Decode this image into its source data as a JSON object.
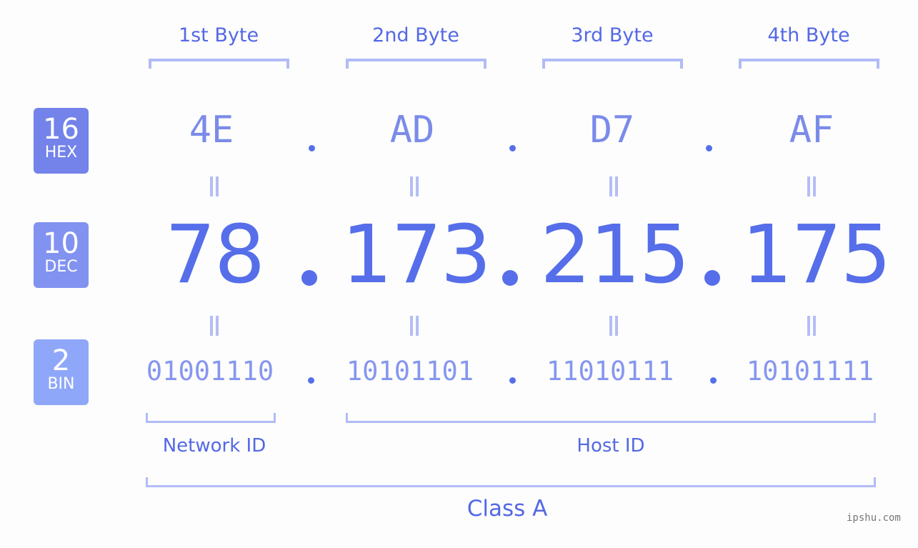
{
  "bytes": [
    {
      "label": "1st Byte",
      "hex": "4E",
      "dec": "78",
      "bin": "01001110"
    },
    {
      "label": "2nd Byte",
      "hex": "AD",
      "dec": "173",
      "bin": "10101101"
    },
    {
      "label": "3rd Byte",
      "hex": "D7",
      "dec": "215",
      "bin": "11010111"
    },
    {
      "label": "4th Byte",
      "hex": "AF",
      "dec": "175",
      "bin": "10101111"
    }
  ],
  "bases": [
    {
      "num": "16",
      "name": "HEX",
      "color": "#7383ea"
    },
    {
      "num": "10",
      "name": "DEC",
      "color": "#8292f0"
    },
    {
      "num": "2",
      "name": "BIN",
      "color": "#8fa7f8"
    }
  ],
  "labels": {
    "network_id": "Network ID",
    "host_id": "Host ID",
    "class": "Class A"
  },
  "watermark": "ipshu.com",
  "colors": {
    "accent": "#566ee9",
    "bracket": "#b2bbf7",
    "hex_text": "#7b8bea",
    "bin_text": "#8796ef"
  }
}
